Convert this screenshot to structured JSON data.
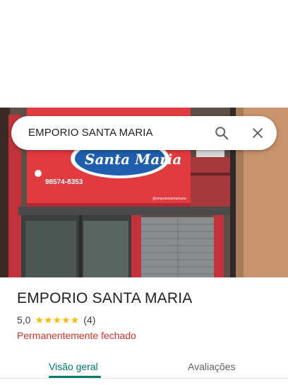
{
  "search": {
    "query": "EMPORIO SANTA MARIA"
  },
  "photo": {
    "sign_text": "Santa Maria",
    "sign_phone": "98574-8353",
    "sign_footer": "@emporiosantamaria"
  },
  "place": {
    "name": "EMPORIO SANTA MARIA",
    "rating": "5,0",
    "stars": 5,
    "review_count": "(4)",
    "status": "Permanentemente fechado"
  },
  "tabs": [
    {
      "label": "Visão geral",
      "active": true
    },
    {
      "label": "Avaliações",
      "active": false
    }
  ],
  "colors": {
    "accent": "#00796b",
    "star": "#fbbc04",
    "closed": "#d93025"
  }
}
